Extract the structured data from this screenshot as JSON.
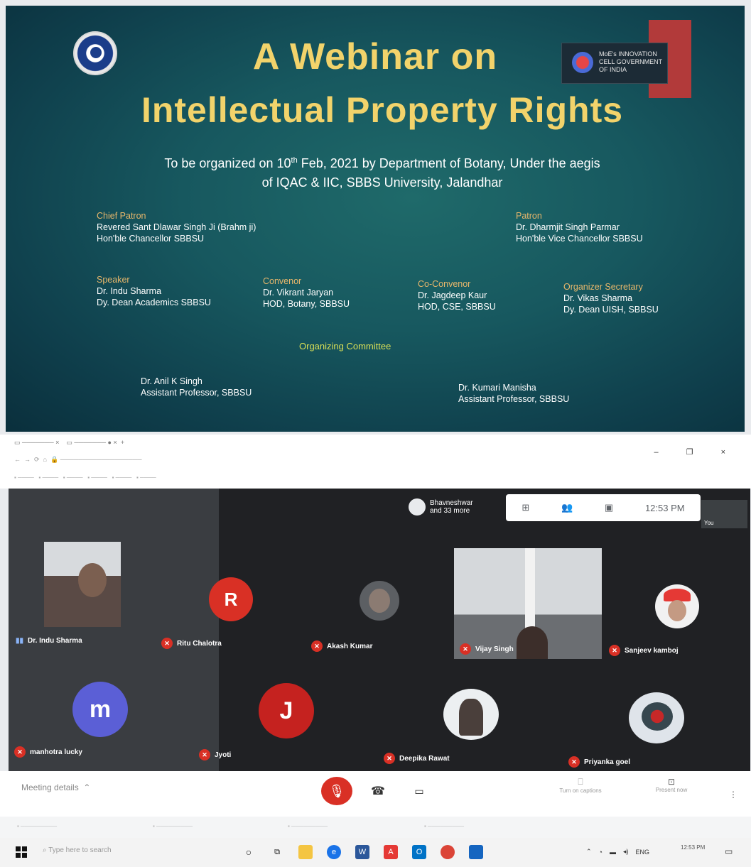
{
  "slide": {
    "title_line1": "A Webinar on",
    "title_line2": "Intellectual Property Rights",
    "subtitle_part1": "To be organized on 10",
    "subtitle_sup": "th",
    "subtitle_part2": " Feb, 2021 by Department of Botany, Under the aegis",
    "subtitle_line2": "of  IQAC & IIC, SBBS University, Jalandhar",
    "mic_logo_text": "MoE's INNOVATION CELL GOVERNMENT OF INDIA",
    "chief_patron": {
      "title": "Chief Patron",
      "line1": "Revered Sant Dlawar Singh Ji (Brahm ji)",
      "line2": "Hon'ble Chancellor SBBSU"
    },
    "patron": {
      "title": "Patron",
      "line1": "Dr. Dharmjit Singh Parmar",
      "line2": "Hon'ble Vice Chancellor SBBSU"
    },
    "speaker": {
      "title": "Speaker",
      "line1": "Dr. Indu Sharma",
      "line2": "Dy. Dean Academics SBBSU"
    },
    "convenor": {
      "title": "Convenor",
      "line1": "Dr. Vikrant Jaryan",
      "line2": "HOD, Botany, SBBSU"
    },
    "co_convenor": {
      "title": "Co-Convenor",
      "line1": "Dr. Jagdeep Kaur",
      "line2": "HOD, CSE, SBBSU"
    },
    "organizer_secretary": {
      "title": "Organizer Secretary",
      "line1": "Dr. Vikas Sharma",
      "line2": "Dy. Dean UISH, SBBSU"
    },
    "organizing_committee": "Organizing Committee",
    "committee_1": {
      "line1": "Dr. Anil K Singh",
      "line2": "Assistant Professor, SBBSU"
    },
    "committee_2": {
      "line1": "Dr. Kumari Manisha",
      "line2": "Assistant Professor, SBBSU"
    }
  },
  "meet": {
    "host_line1": "Bhavneshwar",
    "host_line2": "and 33 more",
    "time": "12:53 PM",
    "you_label": "You",
    "participants": [
      {
        "name": "Dr. Indu Sharma"
      },
      {
        "name": "Ritu Chalotra",
        "initial": "R",
        "color": "#d93025"
      },
      {
        "name": "Akash Kumar"
      },
      {
        "name": "Vijay Singh"
      },
      {
        "name": "Sanjeev kamboj"
      },
      {
        "name": "manhotra lucky",
        "initial": "m",
        "color": "#5b5fd6"
      },
      {
        "name": "Jyoti",
        "initial": "J",
        "color": "#c5221f"
      },
      {
        "name": "Deepika Rawat"
      },
      {
        "name": "Priyanka goel"
      }
    ]
  },
  "bottom": {
    "meeting_details": "Meeting details",
    "captions": "Turn on captions",
    "present": "Present now"
  },
  "taskbar": {
    "search_placeholder": "Type here to search",
    "lang": "ENG",
    "clock_time": "12:53 PM"
  }
}
